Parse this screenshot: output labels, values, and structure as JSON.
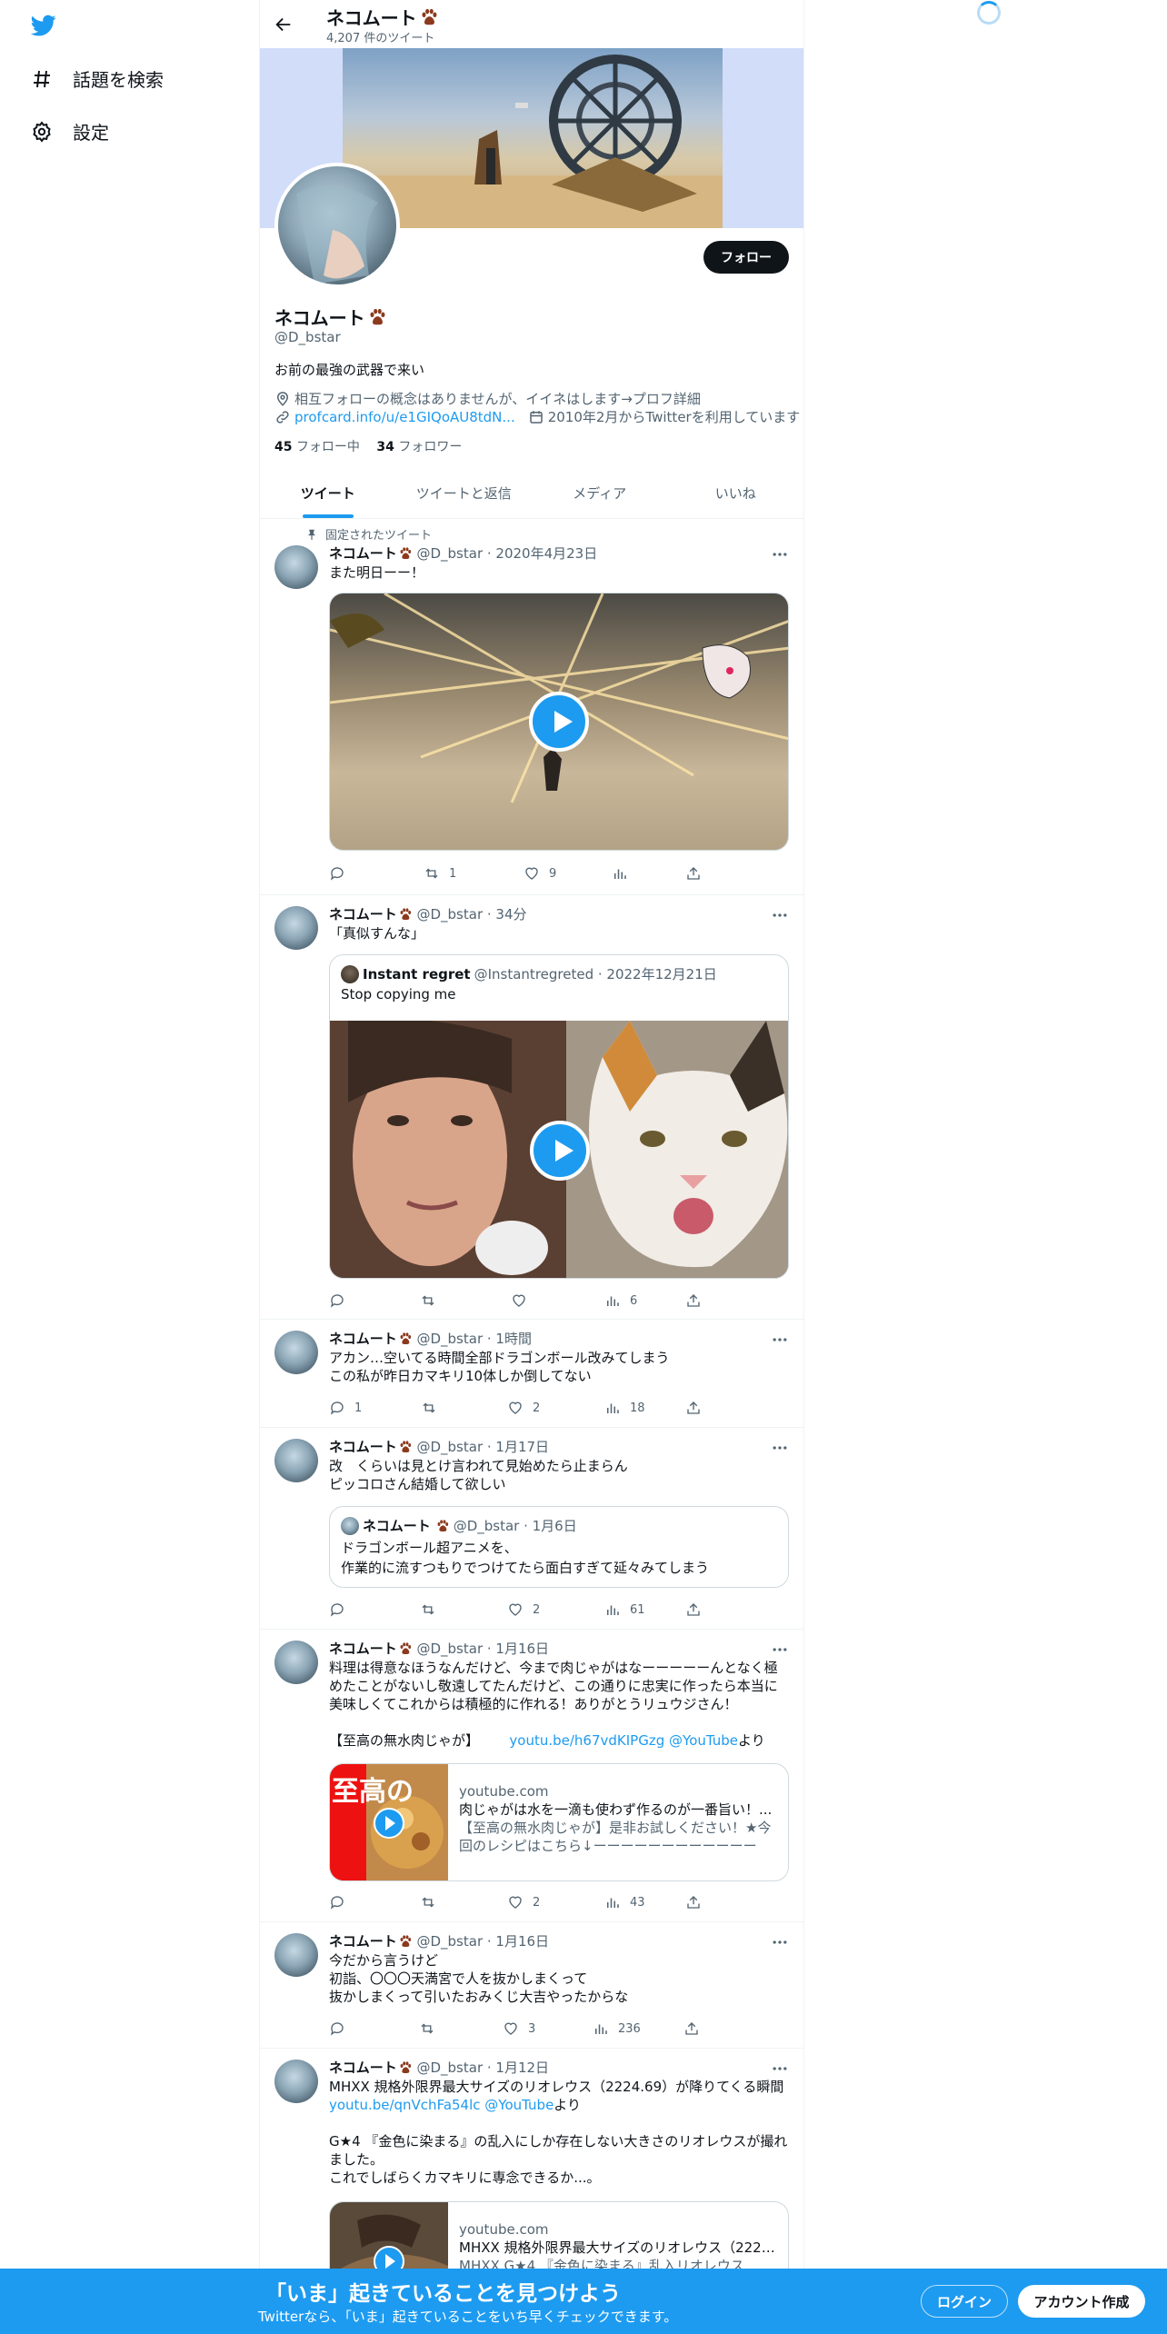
{
  "nav": {
    "explore_label": "話題を検索",
    "settings_label": "設定"
  },
  "header": {
    "title": "ネコムート",
    "tweet_count": "4,207 件のツイート"
  },
  "profile": {
    "name": "ネコムート",
    "handle": "@D_bstar",
    "follow_label": "フォロー",
    "bio": "お前の最強の武器で来い",
    "location": "相互フォローの概念はありませんが、イイネはします→プロフ詳細",
    "url": "profcard.info/u/e1GIQoAU8tdN...",
    "joined": "2010年2月からTwitterを利用しています",
    "following_count": "45",
    "following_label": "フォロー中",
    "followers_count": "34",
    "followers_label": "フォロワー"
  },
  "tabs": [
    "ツイート",
    "ツイートと返信",
    "メディア",
    "いいね"
  ],
  "tweets": [
    {
      "pinned_label": "固定されたツイート",
      "name": "ネコムート",
      "meta": "@D_bstar · 2020年4月23日",
      "text": "また明日ーー！",
      "retweets": "1",
      "likes": "9"
    },
    {
      "name": "ネコムート",
      "meta": "@D_bstar · 34分",
      "text": "「真似すんな」",
      "quote_name": "Instant regret",
      "quote_meta": "@Instantregreted · 2022年12月21日",
      "quote_text": "Stop copying me",
      "views": "6"
    },
    {
      "name": "ネコムート",
      "meta": "@D_bstar · 1時間",
      "text1": "アカン…空いてる時間全部ドラゴンボール改みてしまう",
      "text2": "この私が昨日カマキリ10体しか倒してない",
      "replies": "1",
      "likes": "2",
      "views": "18"
    },
    {
      "name": "ネコムート",
      "meta": "@D_bstar · 1月17日",
      "text1": "改　くらいは見とけ言われて見始めたら止まらん",
      "text2": "ピッコロさん結婚して欲しい",
      "quote_name": "ネコムート",
      "quote_meta": "@D_bstar · 1月6日",
      "quote_text1": "ドラゴンボール超アニメを、",
      "quote_text2": "作業的に流すつもりでつけてたら面白すぎて延々みてしまう",
      "likes": "2",
      "views": "61"
    },
    {
      "name": "ネコムート",
      "meta": "@D_bstar · 1月16日",
      "text1": "料理は得意なほうなんだけど、今まで肉じゃがはなーーーーーんとなく極",
      "text2": "めたことがないし敬遠してたんだけど、この通りに忠実に作ったら本当に",
      "text3": "美味しくてこれからは積極的に作れる！ありがとうリュウジさん！",
      "text4": "【至高の無水肉じゃが】",
      "link": "youtu.be/h67vdKIPGzg",
      "mention": "@YouTube",
      "suffix": "より",
      "card_domain": "youtube.com",
      "card_title": "肉じゃがは水を一滴も使わず作るのが一番旨い！...",
      "card_desc": "【至高の無水肉じゃが】是非お試しください！★今回のレシピはこちら↓ーーーーーーーーーーーーー...",
      "card_thumb_text": "至高の",
      "likes": "2",
      "views": "43"
    },
    {
      "name": "ネコムート",
      "meta": "@D_bstar · 1月16日",
      "text1": "今だから言うけど",
      "text2": "初詣、〇〇〇天満宮で人を抜かしまくって",
      "text3": "抜かしまくって引いたおみくじ大吉やったからな",
      "likes": "3",
      "views": "236"
    },
    {
      "name": "ネコムート",
      "meta": "@D_bstar · 1月12日",
      "text1": "MHXX 規格外限界最大サイズのリオレウス（2224.69）が降りてくる瞬間",
      "link": "youtu.be/qnVchFa54lc",
      "mention": "@YouTube",
      "suffix": "より",
      "text3": "G★4 『金色に染まる』の乱入にしか存在しない大きさのリオレウスが撮れ",
      "text4": "ました。",
      "text5": "これでしばらくカマキリに専念できるか...。",
      "card_domain": "youtube.com",
      "card_title": "MHXX 規格外限界最大サイズのリオレウス（2224...",
      "card_desc": "MHXX G★4 『金色に染まる』乱入リオレウス ..."
    }
  ],
  "bottom": {
    "title": "「いま」起きていることを見つけよう",
    "subtitle": "Twitterなら、「いま」起きていることをいち早くチェックできます。",
    "login": "ログイン",
    "signup": "アカウント作成"
  },
  "colors": {
    "accent": "#1d9bf0",
    "text": "#0f1419",
    "muted": "#536471",
    "border": "#eff3f4"
  }
}
